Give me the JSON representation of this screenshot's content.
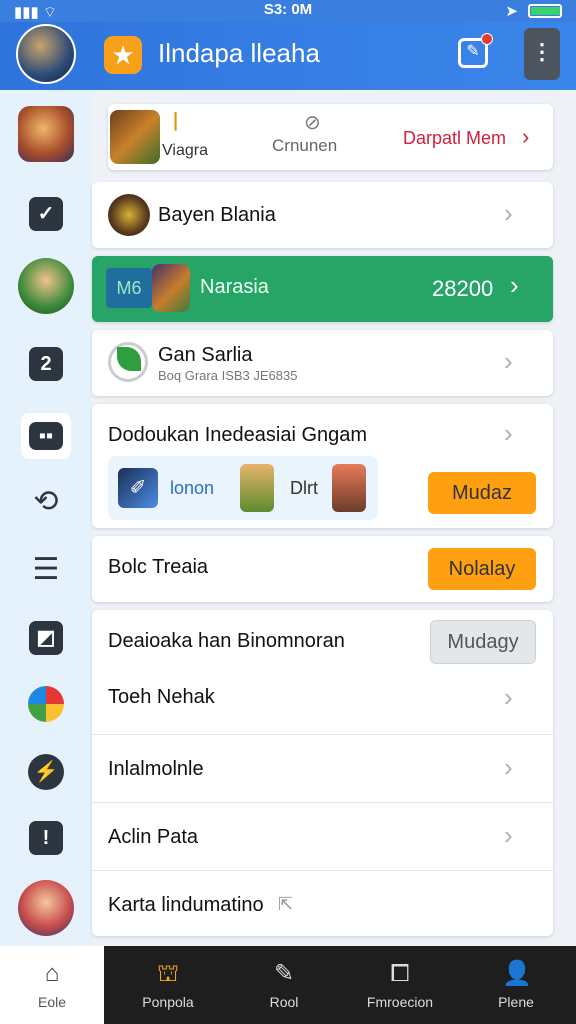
{
  "status_bar": {
    "time": "S3: 0M",
    "battery_level": 0.95
  },
  "header": {
    "title": "Ilndapa lleaha"
  },
  "sidebar": {
    "items": [
      "avatar-1",
      "check",
      "avatar-2",
      "code",
      "briefcase",
      "sync",
      "list",
      "image",
      "color-wheel",
      "lightning",
      "clipboard",
      "avatar-3"
    ]
  },
  "rows": {
    "r1": {
      "label": "Viagra",
      "mid": "Crnunen",
      "link": "Darpatl Mem"
    },
    "r2": {
      "label": "Bayen Blania"
    },
    "r3": {
      "tag": "M6",
      "label": "Narasia",
      "value": "28200"
    },
    "r4": {
      "label": "Gan Sarlia",
      "sub": "Boq Grara ISB3 JE6835"
    },
    "r5": {
      "label": "Dodoukan Inedeasiai Gngam",
      "inner_label": "lonon",
      "inner_text": "Dlrt",
      "button": "Mudaz"
    },
    "r6": {
      "label": "Bolc Treaia",
      "button": "Nolalay"
    },
    "r7": {
      "label": "Deaioaka han Binomnoran",
      "button": "Mudagy"
    },
    "r8": {
      "label": "Toeh Nehak"
    },
    "r9": {
      "label": "Inlalmolnle"
    },
    "r10": {
      "label": "Aclin Pata"
    },
    "r11": {
      "label": "Karta lindumatino"
    }
  },
  "tabbar": {
    "tabs": [
      {
        "label": "Eole"
      },
      {
        "label": "Ponpola"
      },
      {
        "label": "Rool"
      },
      {
        "label": "Fmroecion"
      },
      {
        "label": "Plene"
      }
    ]
  },
  "colors": {
    "brand_blue": "#3a7fe0",
    "accent_orange": "#ff9f12",
    "highlight_green": "#27a567"
  }
}
